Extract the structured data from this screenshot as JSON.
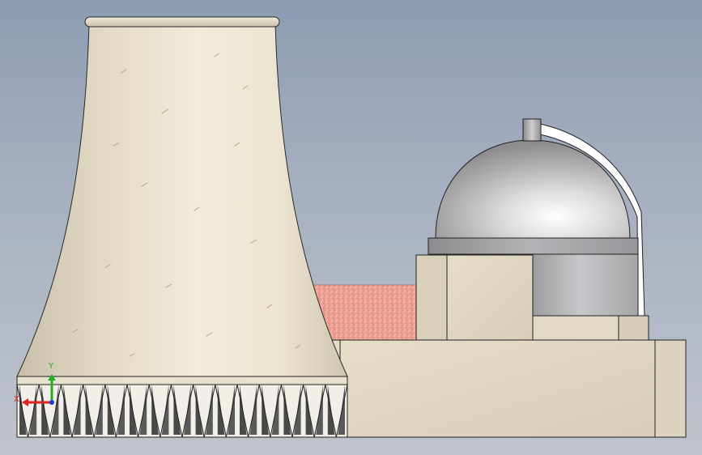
{
  "viewport": {
    "background_top": "#8d9cb3",
    "background_bottom": "#c0c4cc"
  },
  "model": {
    "parts": [
      "cooling-tower",
      "tower-base-lattice",
      "reactor-dome",
      "dome-ring",
      "dome-vent-pipe",
      "reactor-building",
      "base-platform",
      "crushed-stone-yard"
    ],
    "materials": {
      "concrete": "#e3dac6",
      "concrete_shadow": "#b8ae98",
      "dome_metal": "#c9c7c8",
      "ring_metal": "#9a9a9c",
      "yard": "#e69a8c"
    }
  },
  "triad": {
    "x_label": "X",
    "y_label": "Y",
    "x_color": "#e0201a",
    "y_color": "#22b020",
    "z_color": "#1a3fd0"
  }
}
